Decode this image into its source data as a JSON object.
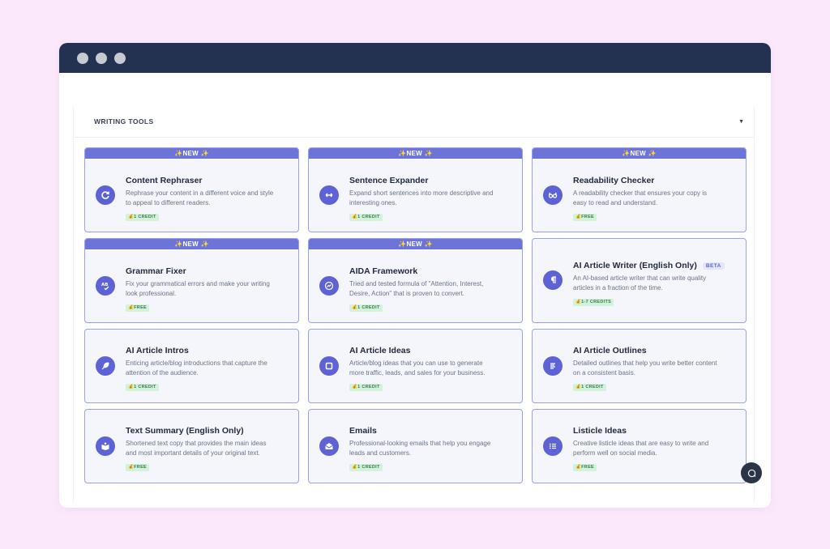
{
  "section": {
    "title": "WRITING TOOLS"
  },
  "ribbon_label": "✨NEW ✨",
  "tools": [
    {
      "title": "Content Rephraser",
      "desc1": "Rephrase your content in a different voice and style",
      "desc2": "to appeal to different readers.",
      "badge": "💰1 CREDIT",
      "icon": "refresh-icon",
      "is_new": true
    },
    {
      "title": "Sentence Expander",
      "desc1": "Expand short sentences into more descriptive and",
      "desc2": "interesting ones.",
      "badge": "💰1 CREDIT",
      "icon": "expand-arrows-icon",
      "is_new": true
    },
    {
      "title": "Readability Checker",
      "desc1": "A readability checker that ensures your copy is",
      "desc2": "easy to read and understand.",
      "badge": "💰FREE",
      "icon": "glasses-icon",
      "is_new": true
    },
    {
      "title": "Grammar Fixer",
      "desc1": "Fix your grammatical errors and make your writing",
      "desc2": "look professional.",
      "badge": "💰FREE",
      "icon": "spellcheck-icon",
      "is_new": true
    },
    {
      "title": "AIDA Framework",
      "desc1": "Tried and tested formula of \"Attention, Interest,",
      "desc2": "Desire, Action\" that is proven to convert.",
      "badge": "💰1 CREDIT",
      "icon": "chart-icon",
      "is_new": true
    },
    {
      "title": "AI Article Writer (English Only)",
      "beta": "BETA",
      "desc1": "An AI-based article writer that can write quality",
      "desc2": "articles in a fraction of the time.",
      "badge": "💰1-7 CREDITS",
      "icon": "paragraph-icon",
      "is_new": false
    },
    {
      "title": "AI Article Intros",
      "desc1": "Enticing article/blog introductions that capture the",
      "desc2": "attention of the audience.",
      "badge": "💰1 CREDIT",
      "icon": "feather-icon",
      "is_new": false
    },
    {
      "title": "AI Article Ideas",
      "desc1": "Article/blog ideas that you can use to generate",
      "desc2": "more traffic, leads, and sales for your business.",
      "badge": "💰1 CREDIT",
      "icon": "note-icon",
      "is_new": false
    },
    {
      "title": "AI Article Outlines",
      "desc1": "Detailed outlines that help you write better content",
      "desc2": "on a consistent basis.",
      "badge": "💰1 CREDIT",
      "icon": "align-left-icon",
      "is_new": false
    },
    {
      "title": "Text Summary (English Only)",
      "desc1": "Shortened text copy that provides the main ideas",
      "desc2": "and most important details of your original text.",
      "badge": "💰FREE",
      "icon": "book-open-icon",
      "is_new": false
    },
    {
      "title": "Emails",
      "desc1": "Professional-looking emails that help you engage",
      "desc2": "leads and customers.",
      "badge": "💰1 CREDIT",
      "icon": "envelope-open-icon",
      "is_new": false
    },
    {
      "title": "Listicle Ideas",
      "desc1": "Creative listicle ideas that are easy to write and",
      "desc2": "perform well on social media.",
      "badge": "💰FREE",
      "icon": "list-icon",
      "is_new": false
    }
  ]
}
